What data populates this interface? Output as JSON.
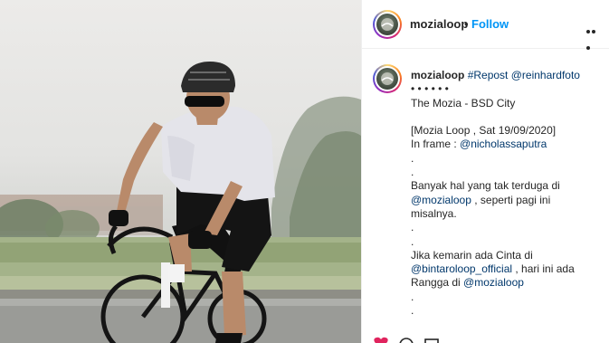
{
  "post": {
    "username": "mozialoop",
    "separator": "•",
    "follow_label": "Follow",
    "more_icon": "more-options-icon"
  },
  "caption": {
    "username": "mozialoop",
    "lines": [
      {
        "parts": [
          {
            "text": "#Repost",
            "kind": "link"
          },
          {
            "text": " ",
            "kind": "text"
          },
          {
            "text": "@reinhardfoto",
            "kind": "link"
          }
        ]
      },
      {
        "parts": [
          {
            "text": "• • • • • •",
            "kind": "text"
          }
        ]
      },
      {
        "parts": [
          {
            "text": "The Mozia - BSD City",
            "kind": "text"
          }
        ]
      },
      {
        "parts": [
          {
            "text": "",
            "kind": "text"
          }
        ]
      },
      {
        "parts": [
          {
            "text": "[Mozia Loop , Sat 19/09/2020]",
            "kind": "text"
          }
        ]
      },
      {
        "parts": [
          {
            "text": "In frame : ",
            "kind": "text"
          },
          {
            "text": "@nicholassaputra",
            "kind": "link"
          }
        ]
      },
      {
        "parts": [
          {
            "text": ".",
            "kind": "text"
          }
        ]
      },
      {
        "parts": [
          {
            "text": ".",
            "kind": "text"
          }
        ]
      },
      {
        "parts": [
          {
            "text": "Banyak hal yang tak terduga di",
            "kind": "text"
          }
        ]
      },
      {
        "parts": [
          {
            "text": "@mozialoop",
            "kind": "link"
          },
          {
            "text": " , seperti pagi ini",
            "kind": "text"
          }
        ]
      },
      {
        "parts": [
          {
            "text": "misalnya.",
            "kind": "text"
          }
        ]
      },
      {
        "parts": [
          {
            "text": ".",
            "kind": "text"
          }
        ]
      },
      {
        "parts": [
          {
            "text": ".",
            "kind": "text"
          }
        ]
      },
      {
        "parts": [
          {
            "text": "Jika kemarin ada Cinta di",
            "kind": "text"
          }
        ]
      },
      {
        "parts": [
          {
            "text": "@bintaroloop_official",
            "kind": "link"
          },
          {
            "text": " , hari ini ada",
            "kind": "text"
          }
        ]
      },
      {
        "parts": [
          {
            "text": "Rangga di ",
            "kind": "text"
          },
          {
            "text": "@mozialoop",
            "kind": "link"
          }
        ]
      },
      {
        "parts": [
          {
            "text": ".",
            "kind": "text"
          }
        ]
      },
      {
        "parts": [
          {
            "text": ".",
            "kind": "text"
          }
        ]
      }
    ]
  },
  "colors": {
    "link": "#00376b",
    "follow": "#0095f6",
    "text": "#262626",
    "border": "#efefef"
  },
  "icons": [
    "heart-icon",
    "comment-icon",
    "share-icon"
  ]
}
